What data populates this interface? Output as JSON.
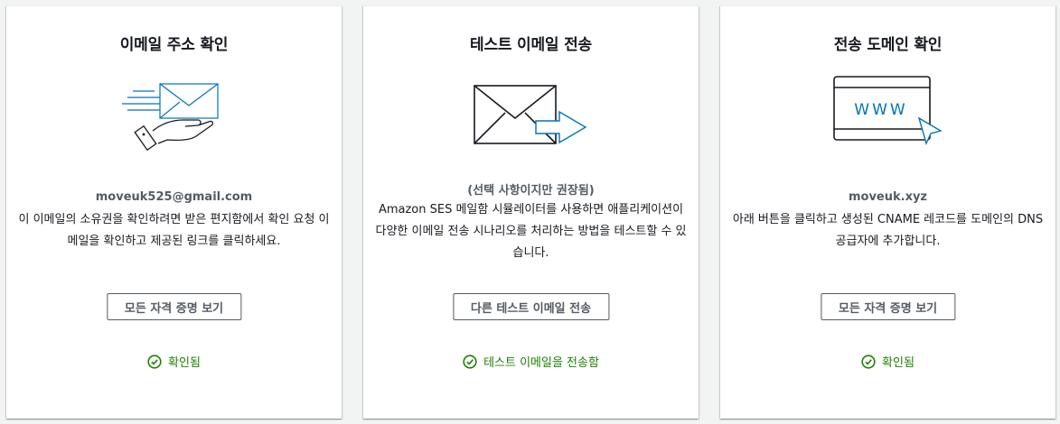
{
  "cards": [
    {
      "title": "이메일 주소 확인",
      "illustration": "hand-envelope-icon",
      "subtitle": "moveuk525@gmail.com",
      "description": "이 이메일의 소유권을 확인하려면 받은 편지함에서 확인 요청 이메일을 확인하고 제공된 링크를 클릭하세요.",
      "button": "모든 자격 증명 보기",
      "status": "확인됨"
    },
    {
      "title": "테스트 이메일 전송",
      "illustration": "send-envelope-icon",
      "subtitle": "(선택 사항이지만 권장됨)",
      "description": "Amazon SES 메일함 시뮬레이터를 사용하면 애플리케이션이 다양한 이메일 전송 시나리오를 처리하는 방법을 테스트할 수 있습니다.",
      "button": "다른 테스트 이메일 전송",
      "status": "테스트 이메일을 전송함"
    },
    {
      "title": "전송 도메인 확인",
      "illustration": "www-browser-icon",
      "illustration_text": "WWW",
      "subtitle": "moveuk.xyz",
      "description": "아래 버튼을 클릭하고 생성된 CNAME 레코드를 도메인의 DNS 공급자에 추가합니다.",
      "button": "모든 자격 증명 보기",
      "status": "확인됨"
    }
  ],
  "colors": {
    "accent_blue": "#0073bb",
    "success_green": "#1d8102",
    "button_border": "#545b64"
  }
}
